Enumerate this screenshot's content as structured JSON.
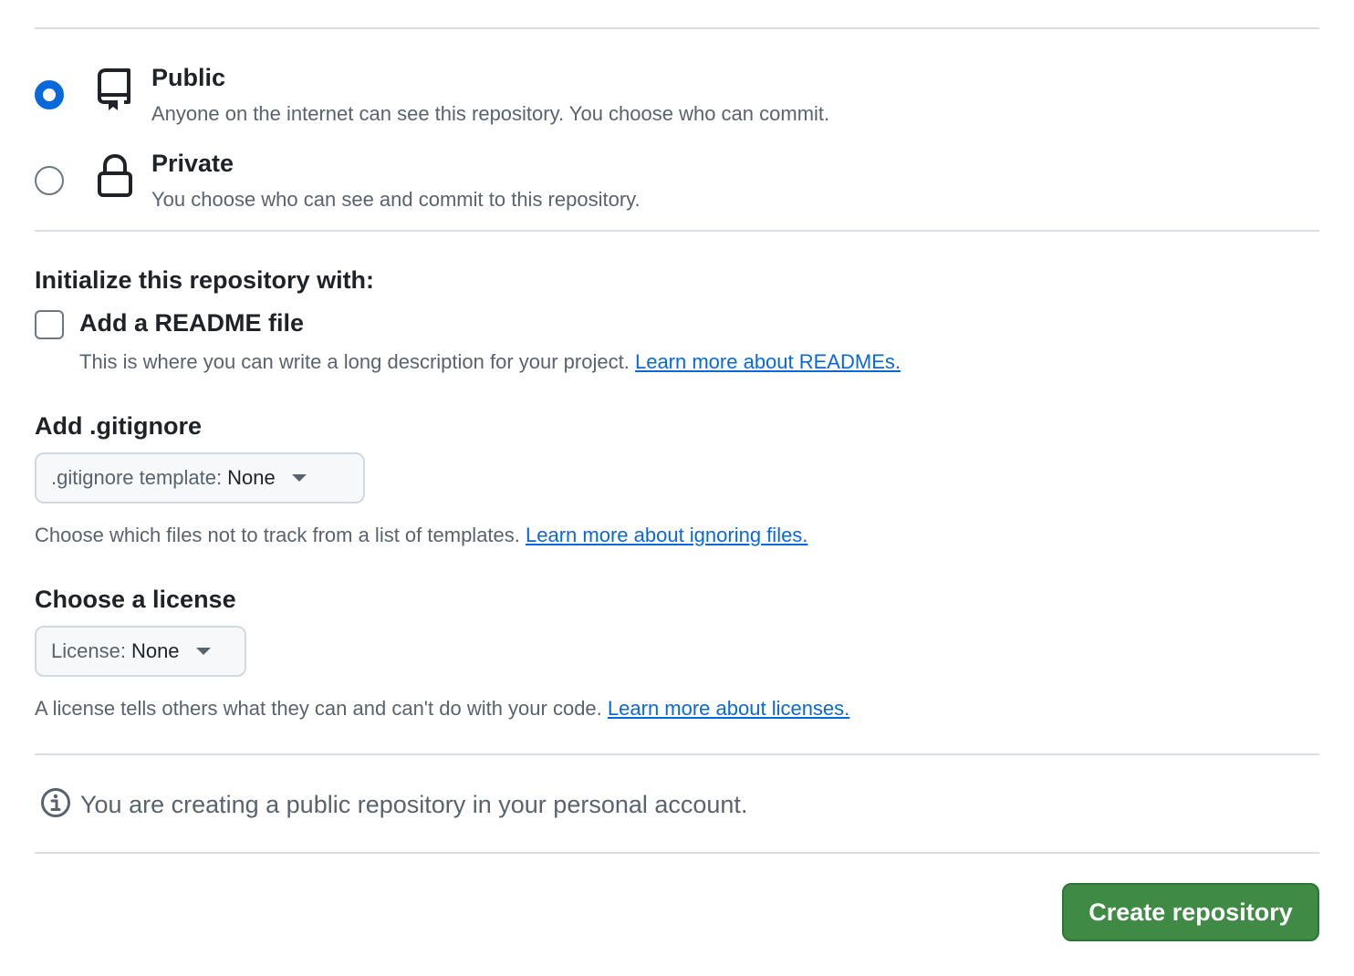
{
  "visibility": {
    "options": [
      {
        "id": "public",
        "title": "Public",
        "description": "Anyone on the internet can see this repository. You choose who can commit.",
        "icon": "repo-icon",
        "selected": true
      },
      {
        "id": "private",
        "title": "Private",
        "description": "You choose who can see and commit to this repository.",
        "icon": "lock-icon",
        "selected": false
      }
    ]
  },
  "initialize": {
    "heading": "Initialize this repository with:",
    "readme": {
      "label": "Add a README file",
      "checked": false,
      "help": "This is where you can write a long description for your project.",
      "link": "Learn more about READMEs."
    }
  },
  "gitignore": {
    "heading": "Add .gitignore",
    "dropdown_prefix": ".gitignore template:",
    "dropdown_value": "None",
    "help": "Choose which files not to track from a list of templates.",
    "link": "Learn more about ignoring files."
  },
  "license": {
    "heading": "Choose a license",
    "dropdown_prefix": "License:",
    "dropdown_value": "None",
    "help": "A license tells others what they can and can't do with your code.",
    "link": "Learn more about licenses."
  },
  "notice": {
    "icon": "info-icon",
    "text": "You are creating a public repository in your personal account."
  },
  "actions": {
    "create_label": "Create repository"
  },
  "colors": {
    "accent": "#0969da",
    "primary_button": "#3f8a44",
    "muted_text": "#59636e",
    "border": "#d8dee4"
  }
}
